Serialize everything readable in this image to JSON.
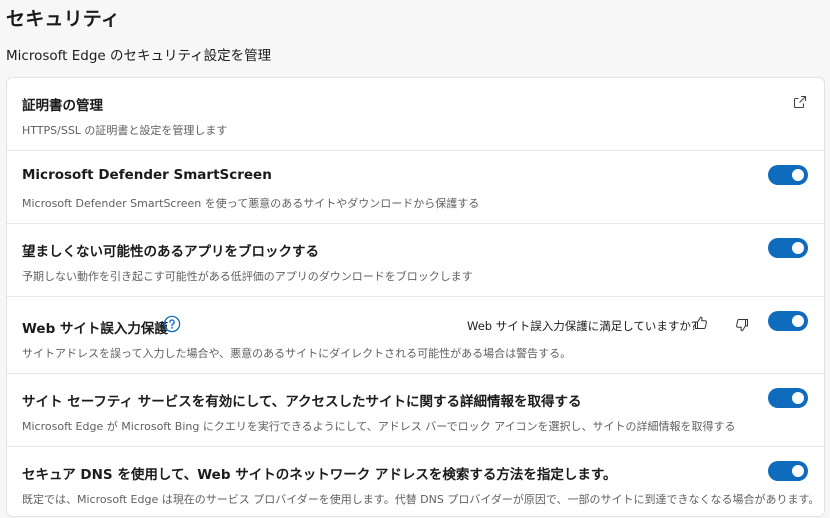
{
  "header": {
    "title": "セキュリティ",
    "subtitle": "Microsoft Edge のセキュリティ設定を管理"
  },
  "settings": [
    {
      "title": "証明書の管理",
      "description": "HTTPS/SSL の証明書と設定を管理します",
      "control": "external-link"
    },
    {
      "title": "Microsoft Defender SmartScreen",
      "description": "Microsoft Defender SmartScreen を使って悪意のあるサイトやダウンロードから保護する",
      "control": "toggle",
      "enabled": true
    },
    {
      "title": "望ましくない可能性のあるアプリをブロックする",
      "description": "予期しない動作を引き起こす可能性がある低評価のアプリのダウンロードをブロックします",
      "control": "toggle",
      "enabled": true
    },
    {
      "title": "Web サイト誤入力保護",
      "description": "サイトアドレスを誤って入力した場合や、悪意のあるサイトにダイレクトされる可能性がある場合は警告する。",
      "feedback_question": "Web サイト誤入力保護に満足していますか?",
      "control": "toggle",
      "enabled": true
    },
    {
      "title": "サイト セーフティ サービスを有効にして、アクセスしたサイトに関する詳細情報を取得する",
      "description": "Microsoft Edge が Microsoft Bing にクエリを実行できるようにして、アドレス バーでロック アイコンを選択し、サイトの詳細情報を取得する",
      "control": "toggle",
      "enabled": true
    },
    {
      "title": "セキュア DNS を使用して、Web サイトのネットワーク アドレスを検索する方法を指定します。",
      "description": "既定では、Microsoft Edge は現在のサービス プロバイダーを使用します。代替 DNS プロバイダーが原因で、一部のサイトに到達できなくなる場合があります。",
      "control": "toggle",
      "enabled": true
    }
  ],
  "colors": {
    "accent": "#0f6cbd",
    "background": "#f7f7f7",
    "card": "#ffffff",
    "muted_text": "#5f5f5f"
  },
  "icons": {
    "external_link": "external-link-icon",
    "help": "help-circle-icon",
    "thumbs_up": "thumbs-up-icon",
    "thumbs_down": "thumbs-down-icon"
  }
}
